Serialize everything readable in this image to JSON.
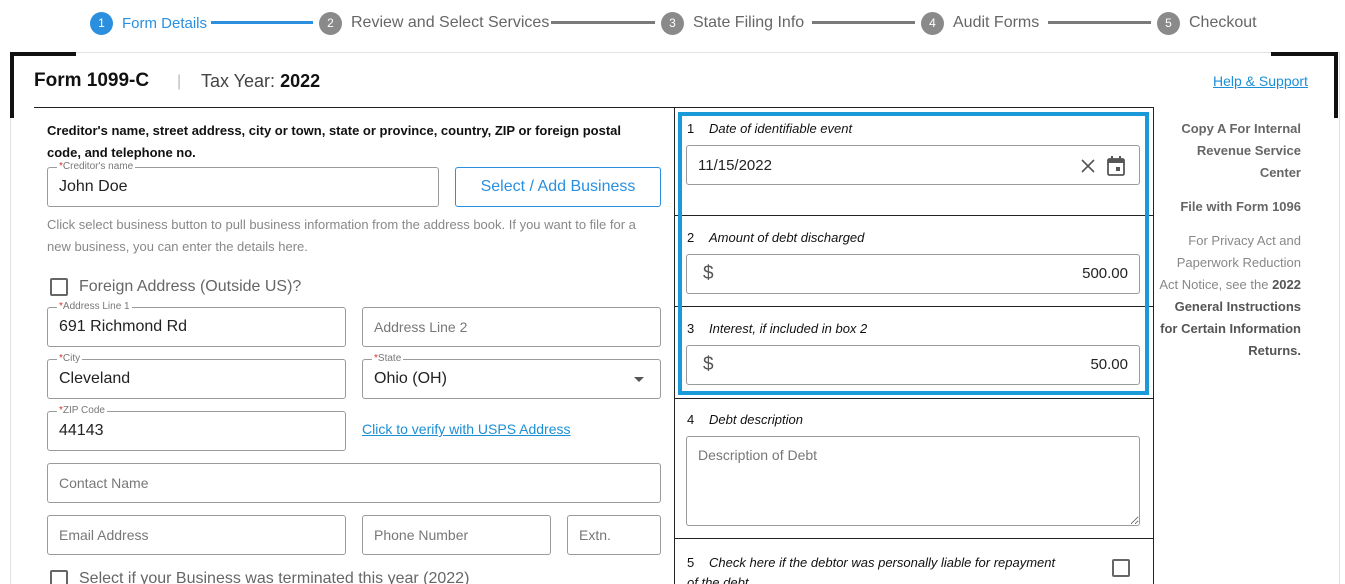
{
  "stepper": [
    {
      "num": "1",
      "label": "Form Details",
      "active": true
    },
    {
      "num": "2",
      "label": "Review and Select Services",
      "active": false
    },
    {
      "num": "3",
      "label": "State Filing Info",
      "active": false
    },
    {
      "num": "4",
      "label": "Audit Forms",
      "active": false
    },
    {
      "num": "5",
      "label": "Checkout",
      "active": false
    }
  ],
  "header": {
    "form_title": "Form 1099-C",
    "separator": "|",
    "tax_year_label": "Tax Year:",
    "tax_year": "2022",
    "help_link": "Help & Support"
  },
  "creditor": {
    "heading": "Creditor's name, street address, city or town, state or province, country, ZIP or foreign postal code, and telephone no.",
    "name_label": "Creditor's name",
    "name_value": "John Doe",
    "select_button": "Select / Add Business",
    "help_text": "Click select business button to pull business information from the address book. If you want to file for a new business, you can enter the details here.",
    "foreign_label": "Foreign Address (Outside US)?",
    "address1_label": "Address Line 1",
    "address1_value": "691 Richmond Rd",
    "address2_placeholder": "Address Line 2",
    "city_label": "City",
    "city_value": "Cleveland",
    "state_label": "State",
    "state_value": "Ohio (OH)",
    "zip_label": "ZIP Code",
    "zip_value": "44143",
    "usps_link": "Click to verify with USPS Address",
    "contact_placeholder": "Contact Name",
    "email_placeholder": "Email Address",
    "phone_placeholder": "Phone Number",
    "ext_placeholder": "Extn.",
    "terminated_label": "Select if your Business was terminated this year (2022)"
  },
  "boxes": {
    "box1": {
      "num": "1",
      "label": "Date of identifiable event",
      "value": "11/15/2022"
    },
    "box2": {
      "num": "2",
      "label": "Amount of debt discharged",
      "currency": "$",
      "value": "500.00"
    },
    "box3": {
      "num": "3",
      "label": "Interest, if included in box 2",
      "currency": "$",
      "value": "50.00"
    },
    "box4": {
      "num": "4",
      "label": "Debt description",
      "placeholder": "Description of Debt"
    },
    "box5": {
      "num": "5",
      "label": "Check here if the debtor was personally liable for repayment of the debt"
    }
  },
  "copy_info": {
    "copy_a": "Copy A For Internal Revenue Service Center",
    "file_with": "File with Form 1096",
    "notice_pre": "For Privacy Act and Paperwork Reduction Act Notice, see the",
    "notice_bold": "2022 General Instructions for Certain Information Returns."
  },
  "colors": {
    "accent": "#2b8fe0",
    "highlight_frame": "#1a9ad8",
    "link": "#1a8fd6",
    "required": "#d0342c"
  }
}
